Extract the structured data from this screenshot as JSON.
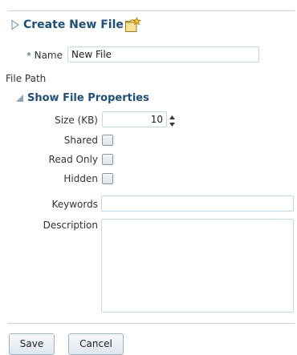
{
  "header": {
    "title": "Create New File",
    "disclosure_icon": "triangle-right-outline-icon",
    "title_icon": "new-file-folder-icon"
  },
  "form": {
    "name": {
      "required_mark": "*",
      "label": "Name",
      "value": "New File"
    },
    "file_path": {
      "label": "File Path"
    },
    "properties_section": {
      "label": "Show File Properties",
      "expanded": true,
      "icon": "triangle-down-expanded-icon"
    },
    "size": {
      "label": "Size (KB)",
      "value": "10"
    },
    "shared": {
      "label": "Shared",
      "checked": false
    },
    "read_only": {
      "label": "Read Only",
      "checked": false
    },
    "hidden": {
      "label": "Hidden",
      "checked": false
    },
    "keywords": {
      "label": "Keywords",
      "value": ""
    },
    "description": {
      "label": "Description",
      "value": ""
    }
  },
  "buttons": {
    "save_label": "Save",
    "cancel_label": "Cancel"
  },
  "colors": {
    "title": "#1f4e79",
    "field_border": "#c3d9e9",
    "separator": "#c9d0d6"
  }
}
